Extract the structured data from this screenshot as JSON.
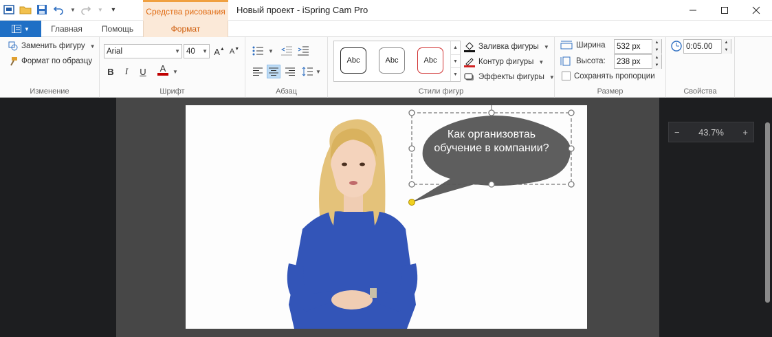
{
  "titlebar": {
    "context_tab": "Средства рисования",
    "title": "Новый проект - iSpring Cam Pro"
  },
  "tabs": {
    "home": "Главная",
    "help": "Помощь",
    "format": "Формат"
  },
  "ribbon": {
    "change": {
      "replace_shape": "Заменить фигуру",
      "format_painter": "Формат по образцу",
      "label": "Изменение"
    },
    "font": {
      "name": "Arial",
      "size": "40",
      "bold": "B",
      "italic": "I",
      "underline": "U",
      "color_letter": "A",
      "label": "Шрифт"
    },
    "paragraph": {
      "label": "Абзац"
    },
    "shape_styles": {
      "thumbs": [
        "Abc",
        "Abc",
        "Abc"
      ],
      "fill": "Заливка фигуры",
      "outline": "Контур фигуры",
      "effects": "Эффекты фигуры",
      "label": "Стили фигур"
    },
    "size": {
      "width_label": "Ширина",
      "width_value": "532 px",
      "height_label": "Высота:",
      "height_value": "238 px",
      "keep_ratio": "Сохранять пропорции",
      "label": "Размер"
    },
    "properties": {
      "time": "0:05.00",
      "label": "Свойства"
    }
  },
  "canvas": {
    "callout_text": "Как организовтаь обучение в компании?"
  },
  "zoom": {
    "minus": "−",
    "value": "43.7%",
    "plus": "+"
  },
  "colors": {
    "accent_orange": "#e06a10",
    "file_blue": "#1f6fc5",
    "callout_fill": "#5e5e5e",
    "dress_blue": "#3355b8"
  }
}
